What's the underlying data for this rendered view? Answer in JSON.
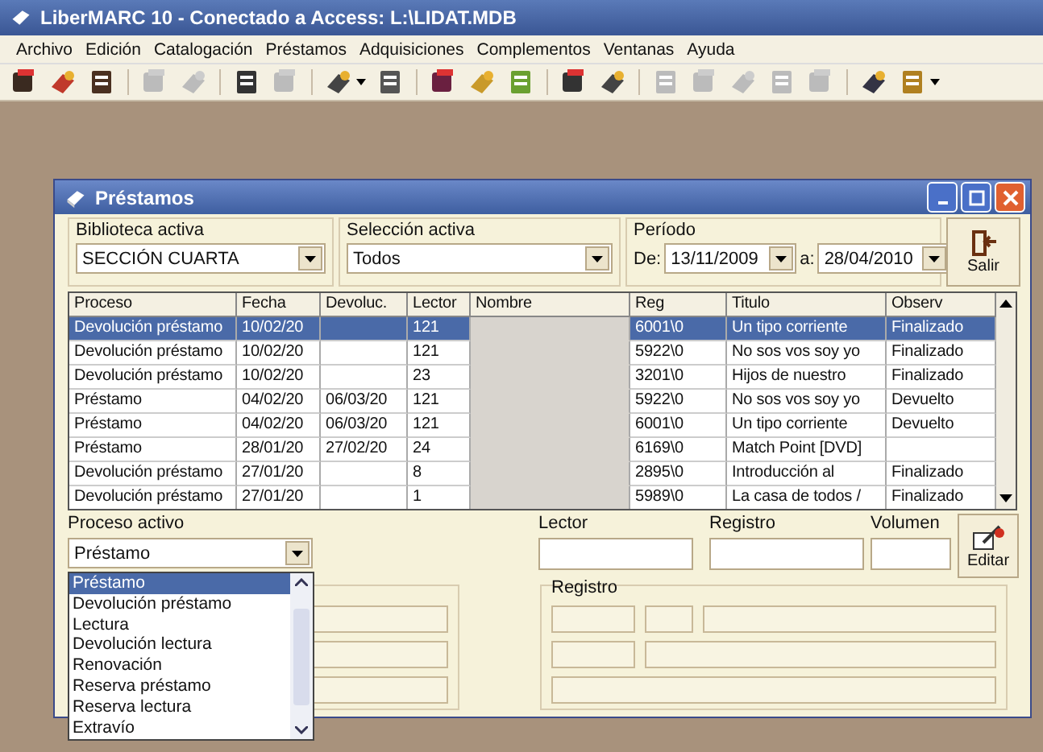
{
  "app": {
    "title": "LiberMARC 10 - Conectado a Access: L:\\LIDAT.MDB"
  },
  "menu": [
    "Archivo",
    "Edición",
    "Catalogación",
    "Préstamos",
    "Adquisiciones",
    "Complementos",
    "Ventanas",
    "Ayuda"
  ],
  "toolbar": [
    [
      {
        "disabled": false
      },
      {
        "disabled": false
      },
      {
        "disabled": false
      }
    ],
    [
      {
        "disabled": true
      },
      {
        "disabled": true
      }
    ],
    [
      {
        "disabled": false
      },
      {
        "disabled": true
      }
    ],
    [
      {
        "disabled": false,
        "dropdown": true
      },
      {
        "disabled": false
      }
    ],
    [
      {
        "disabled": false
      },
      {
        "disabled": false
      },
      {
        "disabled": false
      }
    ],
    [
      {
        "disabled": false
      },
      {
        "disabled": false
      }
    ],
    [
      {
        "disabled": true
      },
      {
        "disabled": true
      },
      {
        "disabled": true
      },
      {
        "disabled": true
      },
      {
        "disabled": true
      }
    ],
    [
      {
        "disabled": false
      },
      {
        "disabled": false,
        "dropdown": true
      }
    ]
  ],
  "window": {
    "title": "Préstamos"
  },
  "filters": {
    "biblioteca": {
      "label": "Biblioteca activa",
      "value": "SECCIÓN CUARTA"
    },
    "seleccion": {
      "label": "Selección activa",
      "value": "Todos"
    },
    "periodo": {
      "label": "Período",
      "from_label": "De:",
      "from": "13/11/2009",
      "to_label": "a:",
      "to": "28/04/2010"
    }
  },
  "exit_button": "Salir",
  "table": {
    "columns": [
      "Proceso",
      "Fecha",
      "Devoluc.",
      "Lector",
      "Nombre",
      "Reg",
      "Titulo",
      "Observ"
    ],
    "rows": [
      {
        "selected": true,
        "proceso": "Devolución préstamo",
        "fecha": "10/02/20",
        "lector": "121",
        "reg": "6001\\0",
        "titulo": "Un  tipo corriente",
        "observ": "Finalizado"
      },
      {
        "selected": false,
        "proceso": "Devolución préstamo",
        "fecha": "10/02/20",
        "lector": "121",
        "reg": "5922\\0",
        "titulo": "No sos vos soy yo",
        "observ": "Finalizado"
      },
      {
        "selected": false,
        "proceso": "Devolución préstamo",
        "fecha": "10/02/20",
        "lector": "23",
        "reg": "3201\\0",
        "titulo": "Hijos de nuestro",
        "observ": "Finalizado"
      },
      {
        "selected": false,
        "proceso": "Préstamo",
        "fecha": "04/02/20",
        "devoluc": "06/03/20",
        "lector": "121",
        "reg": "5922\\0",
        "titulo": "No sos vos soy yo",
        "observ": "Devuelto"
      },
      {
        "selected": false,
        "proceso": "Préstamo",
        "fecha": "04/02/20",
        "devoluc": "06/03/20",
        "lector": "121",
        "reg": "6001\\0",
        "titulo": "Un  tipo corriente",
        "observ": "Devuelto"
      },
      {
        "selected": false,
        "proceso": "Préstamo",
        "fecha": "28/01/20",
        "devoluc": "27/02/20",
        "lector": "24",
        "reg": "6169\\0",
        "titulo": "Match Point [DVD]"
      },
      {
        "selected": false,
        "proceso": "Devolución préstamo",
        "fecha": "27/01/20",
        "lector": "8",
        "reg": "2895\\0",
        "titulo": "Introducción al",
        "observ": "Finalizado"
      },
      {
        "selected": false,
        "proceso": "Devolución préstamo",
        "fecha": "27/01/20",
        "lector": "1",
        "reg": "5989\\0",
        "titulo": "La casa de todos /",
        "observ": "Finalizado"
      }
    ]
  },
  "proceso": {
    "label": "Proceso activo",
    "value": "Préstamo",
    "options": [
      {
        "label": "Préstamo",
        "selected": true
      },
      {
        "label": "Devolución préstamo",
        "selected": false
      },
      {
        "label": "Lectura",
        "selected": false
      },
      {
        "label": "Devolución lectura",
        "selected": false
      },
      {
        "label": "Renovación",
        "selected": false
      },
      {
        "label": "Reserva préstamo",
        "selected": false
      },
      {
        "label": "Reserva lectura",
        "selected": false
      },
      {
        "label": "Extravío",
        "selected": false
      }
    ]
  },
  "lector": {
    "label": "Lector"
  },
  "registro": {
    "label": "Registro"
  },
  "volumen": {
    "label": "Volumen"
  },
  "edit_button": "Editar",
  "registro_group": {
    "title": "Registro"
  }
}
